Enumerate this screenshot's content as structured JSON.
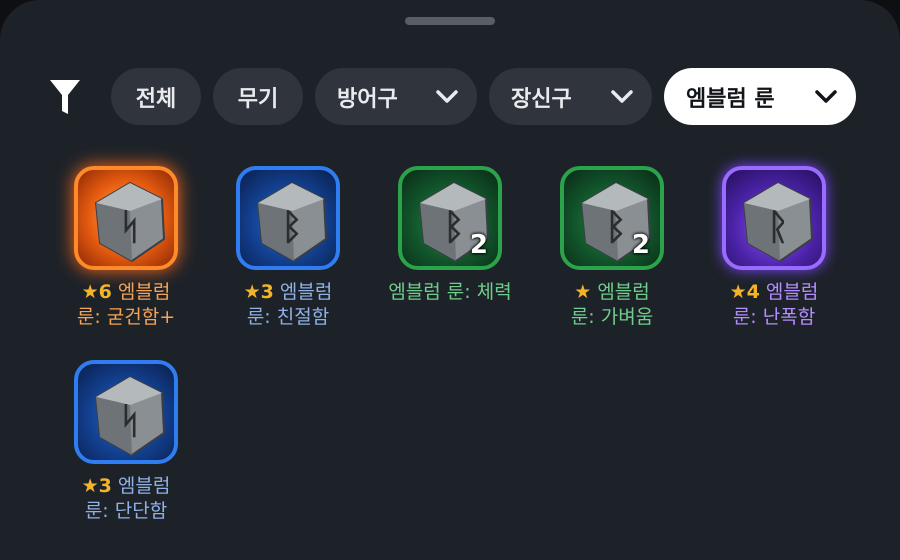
{
  "filter_bar": {
    "icon": "filter-icon",
    "chips": [
      {
        "label": "전체"
      },
      {
        "label": "무기"
      },
      {
        "label": "방어구"
      },
      {
        "label": "장신구"
      },
      {
        "label": "엠블럼 룬",
        "selected": true
      }
    ]
  },
  "items": [
    {
      "star": "★6",
      "name_line1": "엠블럼",
      "name_line2": "룬: 굳건함+",
      "count": "",
      "color": "#f7a352",
      "rune": "ᛋ"
    },
    {
      "star": "★3",
      "name_line1": "엠블럼",
      "name_line2": "룬: 친절함",
      "count": "",
      "color": "#8fb2e6",
      "rune": "ᛒ"
    },
    {
      "star": "",
      "name_line1": "엠블럼 룬: 체력",
      "name_line2": "",
      "count": "2",
      "color": "#6fce8a",
      "rune": "ᛒ"
    },
    {
      "star": "★",
      "name_line1": "엠블럼",
      "name_line2": "룬: 가벼움",
      "count": "2",
      "color": "#6fce8a",
      "rune": "ᛒ"
    },
    {
      "star": "★4",
      "name_line1": "엠블럼",
      "name_line2": "룬: 난폭함",
      "count": "",
      "color": "#b58cff",
      "rune": "ᚱ"
    },
    {
      "star": "★3",
      "name_line1": "엠블럼",
      "name_line2": "룬: 단단함",
      "count": "",
      "color": "#8fb2e6",
      "rune": "ᛋ"
    }
  ]
}
